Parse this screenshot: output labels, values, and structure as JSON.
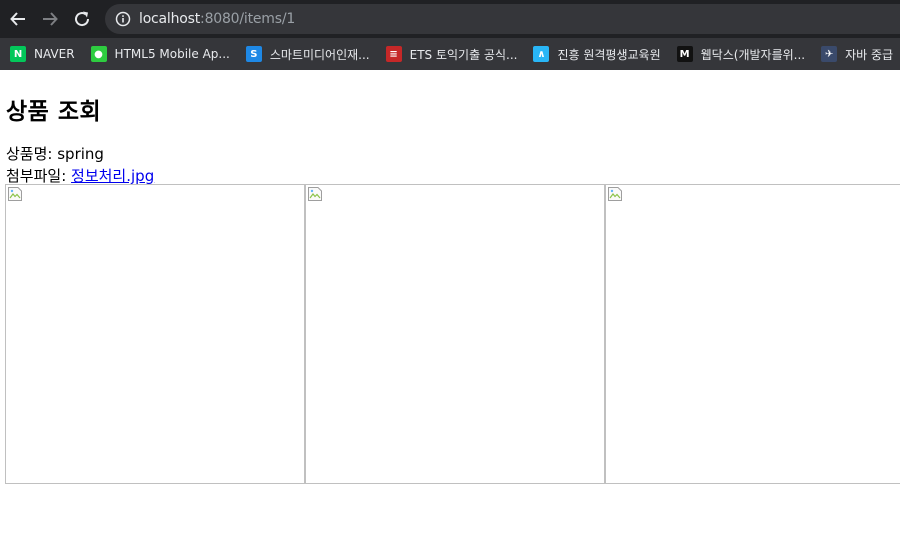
{
  "browser": {
    "url_host": "localhost",
    "url_rest": ":8080/items/1",
    "bookmarks": [
      {
        "icon": "naver-icon",
        "label": "NAVER",
        "color": "#03c75a",
        "glyph": "N"
      },
      {
        "icon": "html5-mobile-icon",
        "label": "HTML5 Mobile Ap...",
        "color": "#2ecc40",
        "glyph": "●"
      },
      {
        "icon": "smart-media-icon",
        "label": "스마트미디어인재...",
        "color": "#1e88e5",
        "glyph": "S"
      },
      {
        "icon": "ets-icon",
        "label": "ETS 토익기출 공식...",
        "color": "#c62828",
        "glyph": "≡"
      },
      {
        "icon": "jinheung-icon",
        "label": "진흥 원격평생교육원",
        "color": "#29b6f6",
        "glyph": "∧"
      },
      {
        "icon": "webdocs-icon",
        "label": "웹닥스(개발자를위...",
        "color": "#111111",
        "glyph": "M"
      },
      {
        "icon": "java-icon",
        "label": "자바 중급",
        "color": "#3a4a6b",
        "glyph": "✈"
      }
    ]
  },
  "page": {
    "title": "상품 조회",
    "item_name_label": "상품명: ",
    "item_name": "spring",
    "attach_label": "첨부파일: ",
    "attach_file": "정보처리.jpg",
    "image_count": 3
  }
}
